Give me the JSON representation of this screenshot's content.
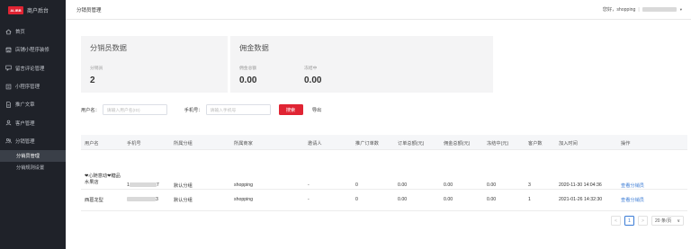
{
  "app": {
    "logo_text": "ALIBB",
    "title": "商户后台"
  },
  "sidebar": {
    "items": [
      {
        "label": "首页",
        "icon": "home-icon"
      },
      {
        "label": "店铺小程序装修",
        "icon": "store-icon"
      },
      {
        "label": "留言评论管理",
        "icon": "comment-icon"
      },
      {
        "label": "小程序管理",
        "icon": "mini-program-icon"
      },
      {
        "label": "推广文章",
        "icon": "article-icon"
      },
      {
        "label": "客户管理",
        "icon": "customer-icon"
      },
      {
        "label": "分销管理",
        "icon": "distribution-icon"
      }
    ],
    "sub_items": [
      {
        "label": "分销员管理",
        "active": true
      },
      {
        "label": "分销规则设置",
        "active": false
      }
    ]
  },
  "header": {
    "breadcrumb": "分销员管理",
    "greeting": "您好，shopping",
    "separator": "|",
    "account_masked": "18000000000"
  },
  "cards": {
    "distributor": {
      "title": "分销员数据",
      "stats": [
        {
          "label": "分销员",
          "value": "2"
        }
      ]
    },
    "commission": {
      "title": "佣金数据",
      "stats": [
        {
          "label": "佣金总额",
          "value": "0.00"
        },
        {
          "label": "冻结中",
          "value": "0.00"
        }
      ]
    }
  },
  "filter": {
    "username_label": "用户名：",
    "username_placeholder": "请输入用户名(ID)",
    "phone_label": "手机号：",
    "phone_placeholder": "请输入手机号",
    "search_label": "搜索",
    "export_label": "导出"
  },
  "table": {
    "headers": [
      "用户名",
      "手机号",
      "所属分组",
      "所属商家",
      "邀请人",
      "推广订单数",
      "订单总额(元)",
      "佣金总额(元)",
      "冻结中(元)",
      "客户数",
      "加入时间",
      "操作"
    ],
    "rows": [
      {
        "nickname": "❤心随意动❤糖品水果店",
        "phone_prefix": "1",
        "phone_suffix": "7",
        "group": "默认分组",
        "merchant": "shopping",
        "inviter": "-",
        "orders": "0",
        "order_total": "0.00",
        "commission_total": "0.00",
        "frozen": "0.00",
        "customers": "3",
        "joined": "2020-11-30 14:04:36",
        "action": "查看分销员"
      },
      {
        "nickname": "西葛龙型",
        "phone_prefix": "",
        "phone_suffix": "3",
        "group": "默认分组",
        "merchant": "shopping",
        "inviter": "-",
        "orders": "0",
        "order_total": "0.00",
        "commission_total": "0.00",
        "frozen": "0.00",
        "customers": "1",
        "joined": "2021-01-26 14:32:30",
        "action": "查看分销员"
      }
    ]
  },
  "pagination": {
    "prev": "<",
    "current_page": "1",
    "next": ">",
    "page_size": "20 条/页",
    "caret": "∨"
  },
  "colors": {
    "sidebar_bg": "#1f2229",
    "accent_red": "#e02433",
    "link_blue": "#3a7bd5"
  }
}
